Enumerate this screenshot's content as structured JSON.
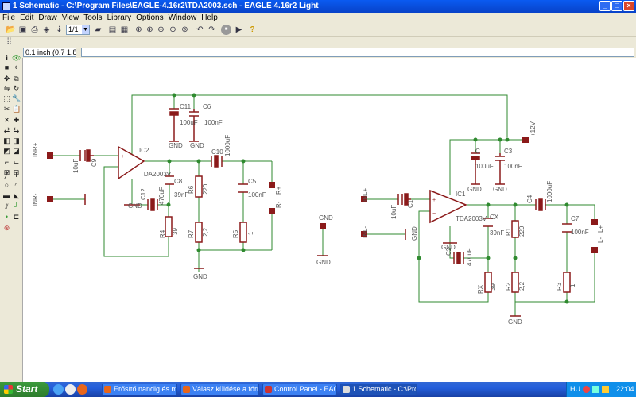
{
  "window": {
    "title": "1 Schematic - C:\\Program Files\\EAGLE-4.16r2\\TDA2003.sch - EAGLE 4.16r2 Light",
    "buttons": [
      "_",
      "□",
      "×"
    ]
  },
  "menu": [
    "File",
    "Edit",
    "Draw",
    "View",
    "Tools",
    "Library",
    "Options",
    "Window",
    "Help"
  ],
  "toolbar": {
    "sheet_select": "1/1",
    "icons": [
      "open-icon",
      "save-icon",
      "print-icon",
      "cam-icon",
      "board-icon",
      "sheet-icon",
      "use-icon",
      "script-icon",
      "run-icon",
      "zoom-fit-icon",
      "zoom-in-icon",
      "zoom-out-icon",
      "zoom-redraw-icon",
      "zoom-select-icon",
      "undo-icon",
      "redo-icon",
      "stop-icon",
      "go-icon",
      "help-icon"
    ]
  },
  "coord_display": "0.1 inch (0.7 1.8)",
  "command_input": "",
  "left_tools": [
    "info",
    "show",
    "display",
    "mark",
    "move",
    "copy",
    "mirror",
    "rotate",
    "group",
    "change",
    "cut",
    "paste",
    "delete",
    "add",
    "pinswap",
    "gateswap",
    "replace",
    "name",
    "value",
    "smash",
    "miter",
    "split",
    "invoke",
    "errc",
    "wire",
    "text",
    "circle",
    "arc",
    "rect",
    "polygon",
    "bus",
    "net",
    "junction",
    "label",
    "attribute",
    "drc"
  ],
  "schematic": {
    "labels": {
      "INR+": "INR+",
      "INR-": "INR-",
      "INL+": "INL+",
      "INL-": "INL-",
      "IC2": "IC2",
      "IC1": "IC1",
      "TDA1": "TDA2003V",
      "TDA2": "TDA2003V",
      "C11": "C11",
      "C6": "C6",
      "C11v": "100uF",
      "C6v": "100nF",
      "C9": "C9",
      "C9v": "10uF",
      "C12": "C12",
      "C12v": "470uF",
      "C8": "C8",
      "C8v": "39nF",
      "C10": "C10",
      "C10v": "1000uF",
      "C5": "C5",
      "C5v": "100nF",
      "RP": "R+",
      "RM": "R-",
      "R4": "R4",
      "R4v": "39",
      "R6": "R6",
      "R6v": "220",
      "R7": "R7",
      "R7v": "2,2",
      "R5": "R5",
      "R5v": "1",
      "GND": "GND",
      "C": "C",
      "Cv": "100uF",
      "C3": "C3",
      "C3v": "100nF",
      "V12": "+12V",
      "C1": "C1",
      "C1v": "10uF",
      "CX": "CX",
      "CXv": "39nF",
      "C2": "C2",
      "C2v": "470uF",
      "C4": "C4",
      "C4v": "1000uF",
      "C7": "C7",
      "C7v": "100nF",
      "LP": "L+",
      "LM": "L-",
      "RX": "RX",
      "RXv": "39",
      "R1": "R1",
      "R1v": "220",
      "R2": "R2",
      "R2v": "2,2",
      "R3": "R3",
      "R3v": "1"
    }
  },
  "taskbar": {
    "start": "Start",
    "tasks": [
      "Erősítő nandig és min...",
      "Válasz küldése a fóru...",
      "Control Panel - EAGL...",
      "1 Schematic - C:\\Prog..."
    ],
    "tray_lang": "HU",
    "clock": "22:04"
  },
  "colors": {
    "net": "#2f8a2f",
    "part": "#8b1a1a",
    "text": "#555555",
    "titlebar": "#0a5bf1"
  }
}
